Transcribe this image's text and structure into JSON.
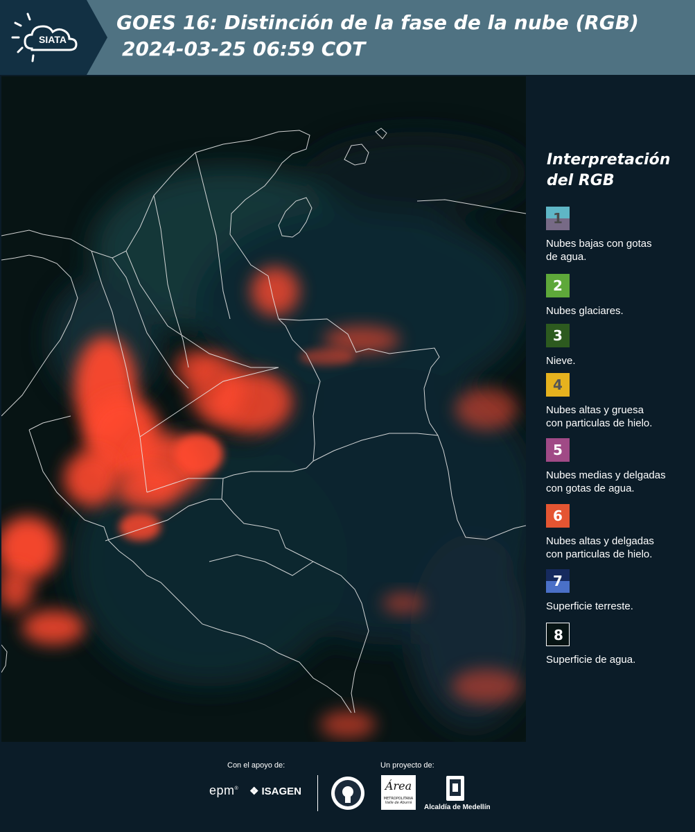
{
  "header": {
    "logo_text": "SIATA",
    "title_line1": "GOES 16: Distinción de la fase de la nube (RGB)",
    "title_line2": "2024-03-25 06:59 COT",
    "colors": {
      "bar": "#4f7282",
      "logo_bg": "#123043"
    }
  },
  "legend": {
    "title_line1": "Interpretación",
    "title_line2": "del RGB",
    "items": [
      {
        "num": "1",
        "label_line1": "Nubes bajas con gotas",
        "label_line2": "de agua.",
        "color_top": "#5fb6c6",
        "color_bottom": "#776a86",
        "num_color": "#4a4a4a"
      },
      {
        "num": "2",
        "label_line1": "Nubes glaciares.",
        "label_line2": "",
        "color_top": "#5ea83a",
        "color_bottom": "#5ea83a",
        "num_color": "#ffffff"
      },
      {
        "num": "3",
        "label_line1": "Nieve.",
        "label_line2": "",
        "color_top": "#2d5a1f",
        "color_bottom": "#2d5a1f",
        "num_color": "#ffffff"
      },
      {
        "num": "4",
        "label_line1": "Nubes altas y gruesa",
        "label_line2": "con particulas de hielo.",
        "color_top": "#e6b21e",
        "color_bottom": "#e6b21e",
        "num_color": "#555555"
      },
      {
        "num": "5",
        "label_line1": "Nubes medias y delgadas",
        "label_line2": "con gotas de agua.",
        "color_top": "#a04a86",
        "color_bottom": "#a04a86",
        "num_color": "#ffffff"
      },
      {
        "num": "6",
        "label_line1": "Nubes altas y delgadas",
        "label_line2": "con particulas de hielo.",
        "color_top": "#e45532",
        "color_bottom": "#e45532",
        "num_color": "#ffffff"
      },
      {
        "num": "7",
        "label_line1": "Superficie terreste.",
        "label_line2": "",
        "color_top": "#162a5e",
        "color_bottom": "#4a70c8",
        "num_color": "#ffffff"
      },
      {
        "num": "8",
        "label_line1": "Superficie de agua.",
        "label_line2": "",
        "color_top": "#071414",
        "color_bottom": "#071414",
        "num_color": "#ffffff",
        "border": "#ffffff"
      }
    ]
  },
  "footer": {
    "support_label": "Con el apoyo de:",
    "project_label": "Un proyecto de:",
    "epm_text": "epm",
    "isagen_text": "ISAGEN",
    "area_text": "Área",
    "area_sub1": "METROPOLITANA",
    "area_sub2": "Valle de Aburrá",
    "alcaldia_text": "Alcaldía de Medellín"
  },
  "map": {
    "water_color": "#071414",
    "cloud_color": "#ff4a2e",
    "border_color": "#e8e8e8"
  }
}
